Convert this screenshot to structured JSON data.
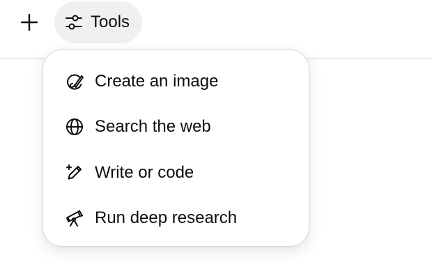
{
  "toolbar": {
    "plus_icon": "plus-icon",
    "tools_label": "Tools",
    "tools_icon": "sliders-icon"
  },
  "menu": {
    "items": [
      {
        "label": "Create an image",
        "icon": "image-brush-icon"
      },
      {
        "label": "Search the web",
        "icon": "globe-icon"
      },
      {
        "label": "Write or code",
        "icon": "pencil-sparkle-icon"
      },
      {
        "label": "Run deep research",
        "icon": "telescope-icon"
      }
    ]
  },
  "colors": {
    "text": "#0d0d0d",
    "tools_button_bg": "#f0f0f0",
    "menu_bg": "#ffffff",
    "border": "#dcdcdc"
  }
}
